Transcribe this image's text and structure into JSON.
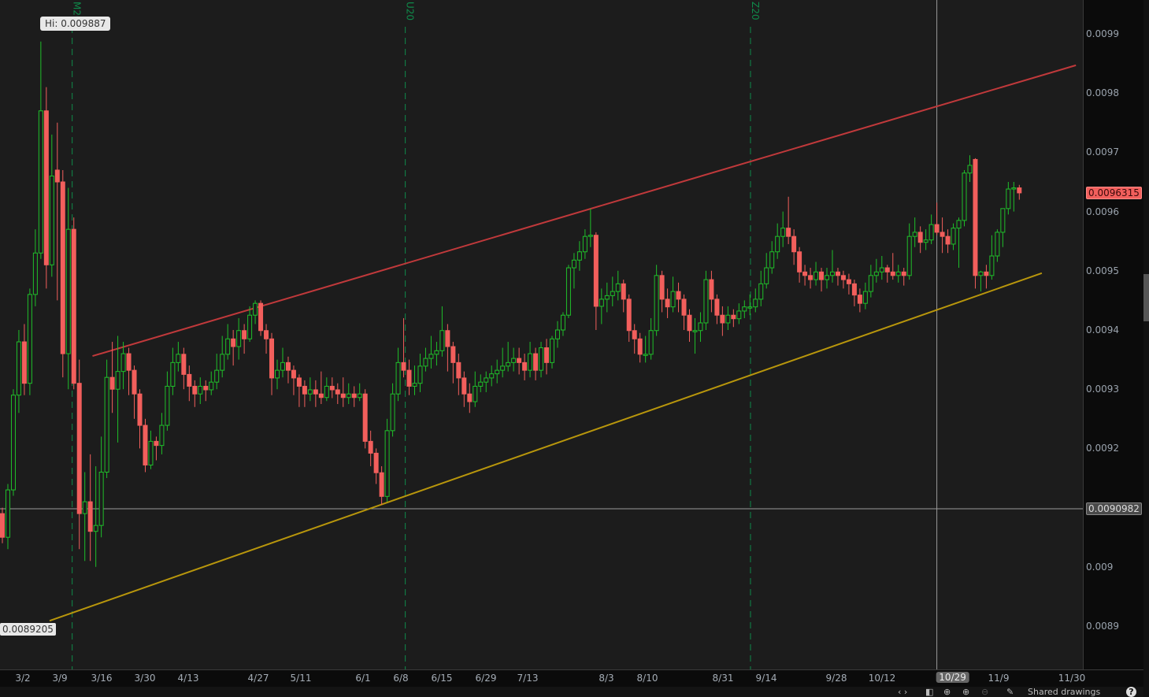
{
  "chart_data": {
    "type": "candlestick",
    "price_unit": "1e-7",
    "ylim": [
      0.00886,
      0.00995
    ],
    "y_ticks": [
      "0.0099",
      "0.0098",
      "0.0097",
      "0.0096",
      "0.0095",
      "0.0094",
      "0.0093",
      "0.0092",
      "0.009",
      "0.0089"
    ],
    "y_tick_values": [
      0.0099,
      0.0098,
      0.0097,
      0.0096,
      0.0095,
      0.0094,
      0.0093,
      0.0092,
      0.009,
      0.0089
    ],
    "x_ticks": [
      "3/2",
      "3/9",
      "3/16",
      "3/30",
      "4/13",
      "4/27",
      "5/11",
      "6/1",
      "6/8",
      "6/15",
      "6/29",
      "7/13",
      "8/3",
      "8/10",
      "8/31",
      "9/14",
      "9/28",
      "10/12",
      "10/29",
      "11/9",
      "11/30"
    ],
    "last_price_label": "0.0096315",
    "crosshair_price_label": "0.0090982",
    "crosshair_price": 0.0090982,
    "crosshair_bar": 170,
    "crosshair_date_label": "10/29",
    "hi_label": "Hi: 0.009887",
    "trendline_price_label": "0.0089205",
    "expiration_markers": [
      {
        "label": "M20",
        "bar": 12.7
      },
      {
        "label": "U20",
        "bar": 73.3
      },
      {
        "label": "Z20",
        "bar": 136.1
      }
    ],
    "trendlines": [
      {
        "name": "resistance",
        "color": "#c0393b",
        "from": [
          16.4,
          93560
        ],
        "to": [
          195.3,
          98470
        ]
      },
      {
        "name": "support",
        "color": "#b8960c",
        "from": [
          8.6,
          89090
        ],
        "to": [
          189.1,
          94960
        ]
      }
    ],
    "colors": {
      "up": "#1fbf2a",
      "down": "#f25f5c",
      "expiry": "#0f8a4a",
      "crosshair": "#9a9a9a"
    },
    "bars_ohlc": [
      [
        90900,
        91000,
        90400,
        90500
      ],
      [
        90500,
        91400,
        90300,
        91300
      ],
      [
        91300,
        93000,
        91200,
        92900
      ],
      [
        92900,
        94000,
        92600,
        93800
      ],
      [
        93800,
        94100,
        92900,
        93100
      ],
      [
        93100,
        94700,
        92900,
        94600
      ],
      [
        94600,
        95700,
        94400,
        95300
      ],
      [
        95300,
        98870,
        95200,
        97700
      ],
      [
        97700,
        98100,
        94700,
        95100
      ],
      [
        95100,
        97300,
        94900,
        96600
      ],
      [
        96700,
        97500,
        94500,
        96500
      ],
      [
        96500,
        96700,
        93200,
        93600
      ],
      [
        93600,
        96400,
        93000,
        95700
      ],
      [
        95700,
        95900,
        93000,
        93100
      ],
      [
        93100,
        93500,
        90300,
        90900
      ],
      [
        90900,
        91600,
        90100,
        91100
      ],
      [
        91100,
        91900,
        90100,
        90600
      ],
      [
        90600,
        91700,
        90000,
        90700
      ],
      [
        90700,
        92200,
        90500,
        91600
      ],
      [
        91600,
        93500,
        91500,
        93200
      ],
      [
        93200,
        93800,
        92600,
        93000
      ],
      [
        93000,
        93900,
        92100,
        93300
      ],
      [
        93300,
        93800,
        93000,
        93600
      ],
      [
        93600,
        93700,
        92900,
        93320
      ],
      [
        93320,
        93400,
        92500,
        92920
      ],
      [
        92920,
        93000,
        92000,
        92390
      ],
      [
        92390,
        92500,
        91600,
        91720
      ],
      [
        91720,
        92300,
        91650,
        92120
      ],
      [
        92120,
        92200,
        91800,
        92050
      ],
      [
        92050,
        92600,
        91900,
        92390
      ],
      [
        92390,
        93300,
        92300,
        93050
      ],
      [
        93050,
        93700,
        92900,
        93450
      ],
      [
        93450,
        93800,
        93300,
        93590
      ],
      [
        93590,
        93700,
        93000,
        93250
      ],
      [
        93250,
        93400,
        92800,
        93050
      ],
      [
        93050,
        93150,
        92700,
        92920
      ],
      [
        92920,
        93200,
        92750,
        93050
      ],
      [
        93050,
        93150,
        92800,
        92990
      ],
      [
        92990,
        93300,
        92900,
        93120
      ],
      [
        93120,
        93600,
        93000,
        93320
      ],
      [
        93320,
        93900,
        93200,
        93590
      ],
      [
        93590,
        94100,
        93500,
        93850
      ],
      [
        93850,
        94000,
        93400,
        93720
      ],
      [
        93720,
        94200,
        93500,
        93990
      ],
      [
        93990,
        94100,
        93600,
        93850
      ],
      [
        93850,
        94400,
        93800,
        94250
      ],
      [
        94250,
        94500,
        94100,
        94450
      ],
      [
        94450,
        94500,
        93900,
        93990
      ],
      [
        93990,
        94100,
        93600,
        93850
      ],
      [
        93850,
        93950,
        92900,
        93190
      ],
      [
        93190,
        93500,
        93000,
        93320
      ],
      [
        93320,
        93700,
        93200,
        93450
      ],
      [
        93450,
        93550,
        93100,
        93320
      ],
      [
        93320,
        93400,
        92900,
        93190
      ],
      [
        93190,
        93250,
        92700,
        93050
      ],
      [
        93050,
        93150,
        92700,
        92920
      ],
      [
        92920,
        93200,
        92800,
        92990
      ],
      [
        92990,
        93150,
        92700,
        92920
      ],
      [
        92920,
        93300,
        92750,
        92860
      ],
      [
        92860,
        93200,
        92800,
        93050
      ],
      [
        93050,
        93200,
        92850,
        92990
      ],
      [
        92990,
        93100,
        92750,
        92920
      ],
      [
        92920,
        93200,
        92700,
        92860
      ],
      [
        92860,
        93100,
        92750,
        92920
      ],
      [
        92920,
        93050,
        92700,
        92860
      ],
      [
        92860,
        93100,
        92800,
        92920
      ],
      [
        92920,
        93000,
        92000,
        92120
      ],
      [
        92120,
        92300,
        91700,
        91920
      ],
      [
        91920,
        92000,
        91400,
        91590
      ],
      [
        91590,
        91700,
        91050,
        91190
      ],
      [
        91190,
        92500,
        91100,
        92300
      ],
      [
        92300,
        93100,
        92200,
        92920
      ],
      [
        92920,
        93700,
        92800,
        93450
      ],
      [
        93450,
        94200,
        93200,
        93320
      ],
      [
        93320,
        93500,
        92900,
        93050
      ],
      [
        93050,
        93400,
        92900,
        93100
      ],
      [
        93100,
        93600,
        92950,
        93390
      ],
      [
        93390,
        93700,
        93300,
        93520
      ],
      [
        93520,
        93900,
        93350,
        93590
      ],
      [
        93590,
        93800,
        93400,
        93650
      ],
      [
        93650,
        94400,
        93550,
        93990
      ],
      [
        93990,
        94100,
        93300,
        93720
      ],
      [
        93720,
        93800,
        93100,
        93450
      ],
      [
        93450,
        93600,
        92900,
        93190
      ],
      [
        93190,
        93300,
        92700,
        92920
      ],
      [
        92920,
        93100,
        92600,
        92790
      ],
      [
        92790,
        93300,
        92700,
        93050
      ],
      [
        93050,
        93250,
        92950,
        93120
      ],
      [
        93120,
        93300,
        92950,
        93190
      ],
      [
        93190,
        93400,
        93050,
        93260
      ],
      [
        93260,
        93500,
        93100,
        93320
      ],
      [
        93320,
        93700,
        93200,
        93390
      ],
      [
        93390,
        93800,
        93300,
        93450
      ],
      [
        93450,
        93700,
        93300,
        93520
      ],
      [
        93520,
        93700,
        93250,
        93450
      ],
      [
        93450,
        93600,
        93150,
        93320
      ],
      [
        93320,
        93800,
        93200,
        93600
      ],
      [
        93600,
        93700,
        93150,
        93320
      ],
      [
        93320,
        93800,
        93200,
        93700
      ],
      [
        93700,
        93850,
        93250,
        93450
      ],
      [
        93450,
        93900,
        93350,
        93850
      ],
      [
        93850,
        94150,
        93700,
        94000
      ],
      [
        94000,
        94300,
        93900,
        94250
      ],
      [
        94250,
        95100,
        94200,
        95050
      ],
      [
        95050,
        95300,
        94700,
        95180
      ],
      [
        95180,
        95500,
        95000,
        95320
      ],
      [
        95320,
        95700,
        95200,
        95580
      ],
      [
        95580,
        96050,
        95400,
        95600
      ],
      [
        95600,
        95650,
        94000,
        94400
      ],
      [
        94400,
        94700,
        94100,
        94520
      ],
      [
        94520,
        94800,
        94300,
        94580
      ],
      [
        94580,
        94900,
        94400,
        94650
      ],
      [
        94650,
        95000,
        94500,
        94780
      ],
      [
        94780,
        94850,
        94300,
        94520
      ],
      [
        94520,
        94600,
        93800,
        93990
      ],
      [
        93990,
        94100,
        93600,
        93850
      ],
      [
        93850,
        93950,
        93450,
        93590
      ],
      [
        93590,
        93900,
        93450,
        93590
      ],
      [
        93590,
        94200,
        93500,
        93990
      ],
      [
        93990,
        95100,
        93900,
        94920
      ],
      [
        94920,
        95000,
        94300,
        94520
      ],
      [
        94520,
        94700,
        94200,
        94390
      ],
      [
        94390,
        94900,
        94300,
        94650
      ],
      [
        94650,
        94800,
        94300,
        94520
      ],
      [
        94520,
        94600,
        94000,
        94250
      ],
      [
        94250,
        94350,
        93800,
        93990
      ],
      [
        93990,
        94200,
        93600,
        93990
      ],
      [
        93990,
        94300,
        93800,
        94120
      ],
      [
        94120,
        95000,
        94000,
        94850
      ],
      [
        94850,
        95000,
        94300,
        94520
      ],
      [
        94520,
        94600,
        94100,
        94250
      ],
      [
        94250,
        94400,
        93900,
        94120
      ],
      [
        94120,
        94400,
        94000,
        94250
      ],
      [
        94250,
        94350,
        94050,
        94190
      ],
      [
        94190,
        94450,
        94100,
        94320
      ],
      [
        94320,
        94500,
        94200,
        94390
      ],
      [
        94390,
        94600,
        94250,
        94390
      ],
      [
        94390,
        94700,
        94300,
        94520
      ],
      [
        94520,
        95000,
        94400,
        94780
      ],
      [
        94780,
        95300,
        94700,
        95050
      ],
      [
        95050,
        95500,
        94950,
        95320
      ],
      [
        95320,
        95800,
        95200,
        95580
      ],
      [
        95580,
        96000,
        95400,
        95720
      ],
      [
        95720,
        96250,
        95450,
        95580
      ],
      [
        95580,
        95700,
        95100,
        95320
      ],
      [
        95320,
        95400,
        94800,
        94980
      ],
      [
        94980,
        95100,
        94750,
        94920
      ],
      [
        94920,
        95050,
        94700,
        94850
      ],
      [
        94850,
        95150,
        94750,
        94980
      ],
      [
        94980,
        95050,
        94650,
        94850
      ],
      [
        94850,
        95050,
        94700,
        94920
      ],
      [
        94920,
        95350,
        94800,
        94980
      ],
      [
        94980,
        95050,
        94750,
        94920
      ],
      [
        94920,
        95000,
        94700,
        94850
      ],
      [
        94850,
        94950,
        94600,
        94780
      ],
      [
        94780,
        94850,
        94400,
        94590
      ],
      [
        94590,
        94700,
        94300,
        94450
      ],
      [
        94450,
        94800,
        94350,
        94650
      ],
      [
        94650,
        95100,
        94550,
        94920
      ],
      [
        94920,
        95200,
        94800,
        94980
      ],
      [
        94980,
        95250,
        94850,
        95050
      ],
      [
        95050,
        95100,
        94800,
        94980
      ],
      [
        94980,
        95300,
        94850,
        94920
      ],
      [
        94920,
        95100,
        94800,
        94980
      ],
      [
        94980,
        95050,
        94750,
        94920
      ],
      [
        94920,
        95800,
        94850,
        95580
      ],
      [
        95580,
        95900,
        95400,
        95650
      ],
      [
        95650,
        95750,
        95300,
        95480
      ],
      [
        95480,
        95700,
        95350,
        95520
      ],
      [
        95520,
        95950,
        95450,
        95780
      ],
      [
        95780,
        96150,
        95600,
        95650
      ],
      [
        95650,
        95900,
        95300,
        95580
      ],
      [
        95580,
        95700,
        95300,
        95450
      ],
      [
        95450,
        95800,
        95350,
        95720
      ],
      [
        95720,
        95900,
        95050,
        95850
      ],
      [
        95850,
        96700,
        95750,
        96650
      ],
      [
        96650,
        96950,
        96500,
        96780
      ],
      [
        96880,
        96900,
        94700,
        94920
      ],
      [
        94920,
        95000,
        94650,
        94980
      ],
      [
        94980,
        95100,
        94700,
        94920
      ],
      [
        94920,
        95600,
        94850,
        95250
      ],
      [
        95250,
        95700,
        95150,
        95650
      ],
      [
        95650,
        96050,
        95400,
        96050
      ],
      [
        96050,
        96500,
        95950,
        96380
      ],
      [
        96380,
        96500,
        96000,
        96400
      ],
      [
        96400,
        96450,
        96200,
        96315
      ]
    ]
  },
  "toolbar": {
    "shared_drawings": "Shared drawings",
    "help": "?"
  }
}
